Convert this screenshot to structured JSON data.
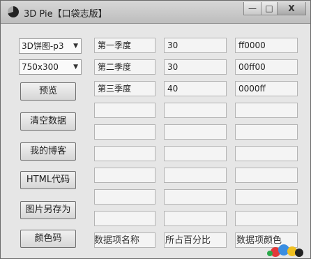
{
  "window": {
    "title": "3D Pie【口袋志版】",
    "min_glyph": "—",
    "max_glyph": "□",
    "close_glyph": "X"
  },
  "left": {
    "chart_type": "3D饼图-p3",
    "size": "750x300",
    "buttons": [
      "预览",
      "清空数据",
      "我的博客",
      "HTML代码",
      "图片另存为",
      "颜色码"
    ]
  },
  "rows": [
    {
      "name": "第一季度",
      "percent": "30",
      "color": "ff0000"
    },
    {
      "name": "第二季度",
      "percent": "30",
      "color": "00ff00"
    },
    {
      "name": "第三季度",
      "percent": "40",
      "color": "0000ff"
    },
    {
      "name": "",
      "percent": "",
      "color": ""
    },
    {
      "name": "",
      "percent": "",
      "color": ""
    },
    {
      "name": "",
      "percent": "",
      "color": ""
    },
    {
      "name": "",
      "percent": "",
      "color": ""
    },
    {
      "name": "",
      "percent": "",
      "color": ""
    },
    {
      "name": "",
      "percent": "",
      "color": ""
    },
    {
      "name": "",
      "percent": "",
      "color": ""
    }
  ],
  "headers": {
    "name": "数据项名称",
    "percent": "所占百分比",
    "color": "数据项颜色"
  }
}
